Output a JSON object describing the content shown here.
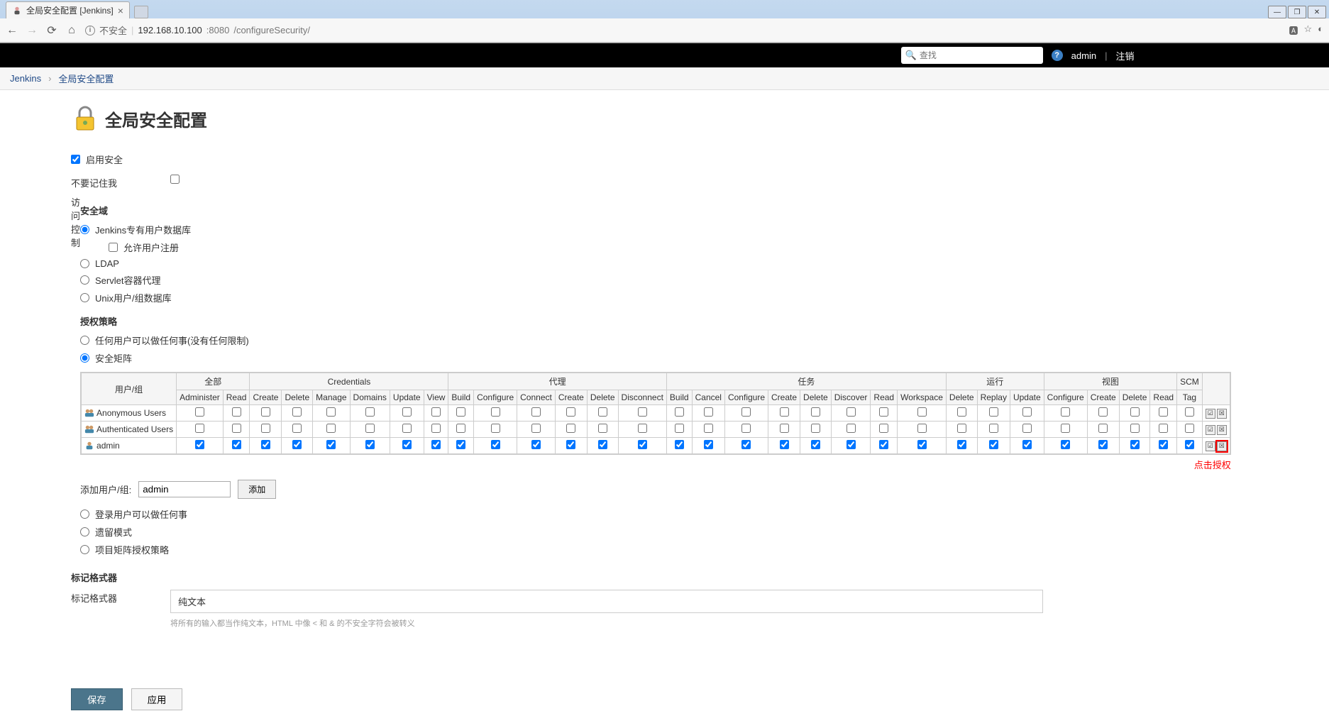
{
  "browser": {
    "tab_title": "全局安全配置 [Jenkins]",
    "insecure_label": "不安全",
    "url_host": "192.168.10.100",
    "url_port": ":8080",
    "url_path": "/configureSecurity/"
  },
  "topbar": {
    "search_placeholder": "查找",
    "user": "admin",
    "logout": "注销"
  },
  "breadcrumb": {
    "root": "Jenkins",
    "current": "全局安全配置"
  },
  "page": {
    "title": "全局安全配置",
    "enable_security": "启用安全",
    "no_remember_me": "不要记住我",
    "access_control": "访问控制",
    "security_realm_heading": "安全域",
    "realms": {
      "jenkins_db": "Jenkins专有用户数据库",
      "allow_signup": "允许用户注册",
      "ldap": "LDAP",
      "servlet": "Servlet容器代理",
      "unix": "Unix用户/组数据库"
    },
    "authz_heading": "授权策略",
    "authz": {
      "anyone": "任何用户可以做任何事(没有任何限制)",
      "matrix": "安全矩阵",
      "logged_in": "登录用户可以做任何事",
      "legacy": "遗留模式",
      "project_matrix": "项目矩阵授权策略"
    },
    "add_user_label": "添加用户/组:",
    "add_user_value": "admin",
    "add_button": "添加",
    "annotation": "点击授权",
    "markup_section": "标记格式器",
    "markup_label": "标记格式器",
    "markup_value": "纯文本",
    "markup_hint": "将所有的输入都当作纯文本，HTML 中像 < 和 & 的不安全字符会被转义",
    "save": "保存",
    "apply": "应用"
  },
  "matrix": {
    "user_group_header": "用户/组",
    "groups": [
      {
        "name": "全部",
        "cols": [
          "Administer",
          "Read"
        ]
      },
      {
        "name": "Credentials",
        "cols": [
          "Create",
          "Delete",
          "Manage",
          "Domains",
          "Update",
          "View"
        ]
      },
      {
        "name": "代理",
        "cols": [
          "Build",
          "Configure",
          "Connect",
          "Create",
          "Delete",
          "Disconnect"
        ]
      },
      {
        "name": "任务",
        "cols": [
          "Build",
          "Cancel",
          "Configure",
          "Create",
          "Delete",
          "Discover",
          "Read",
          "Workspace"
        ]
      },
      {
        "name": "运行",
        "cols": [
          "Delete",
          "Replay",
          "Update"
        ]
      },
      {
        "name": "视图",
        "cols": [
          "Configure",
          "Create",
          "Delete",
          "Read"
        ]
      },
      {
        "name": "SCM",
        "cols": [
          "Tag"
        ]
      }
    ],
    "rows": [
      {
        "label": "Anonymous Users",
        "icon": "group",
        "all_checked": false
      },
      {
        "label": "Authenticated Users",
        "icon": "group",
        "all_checked": false
      },
      {
        "label": "admin",
        "icon": "person",
        "all_checked": true
      }
    ]
  }
}
